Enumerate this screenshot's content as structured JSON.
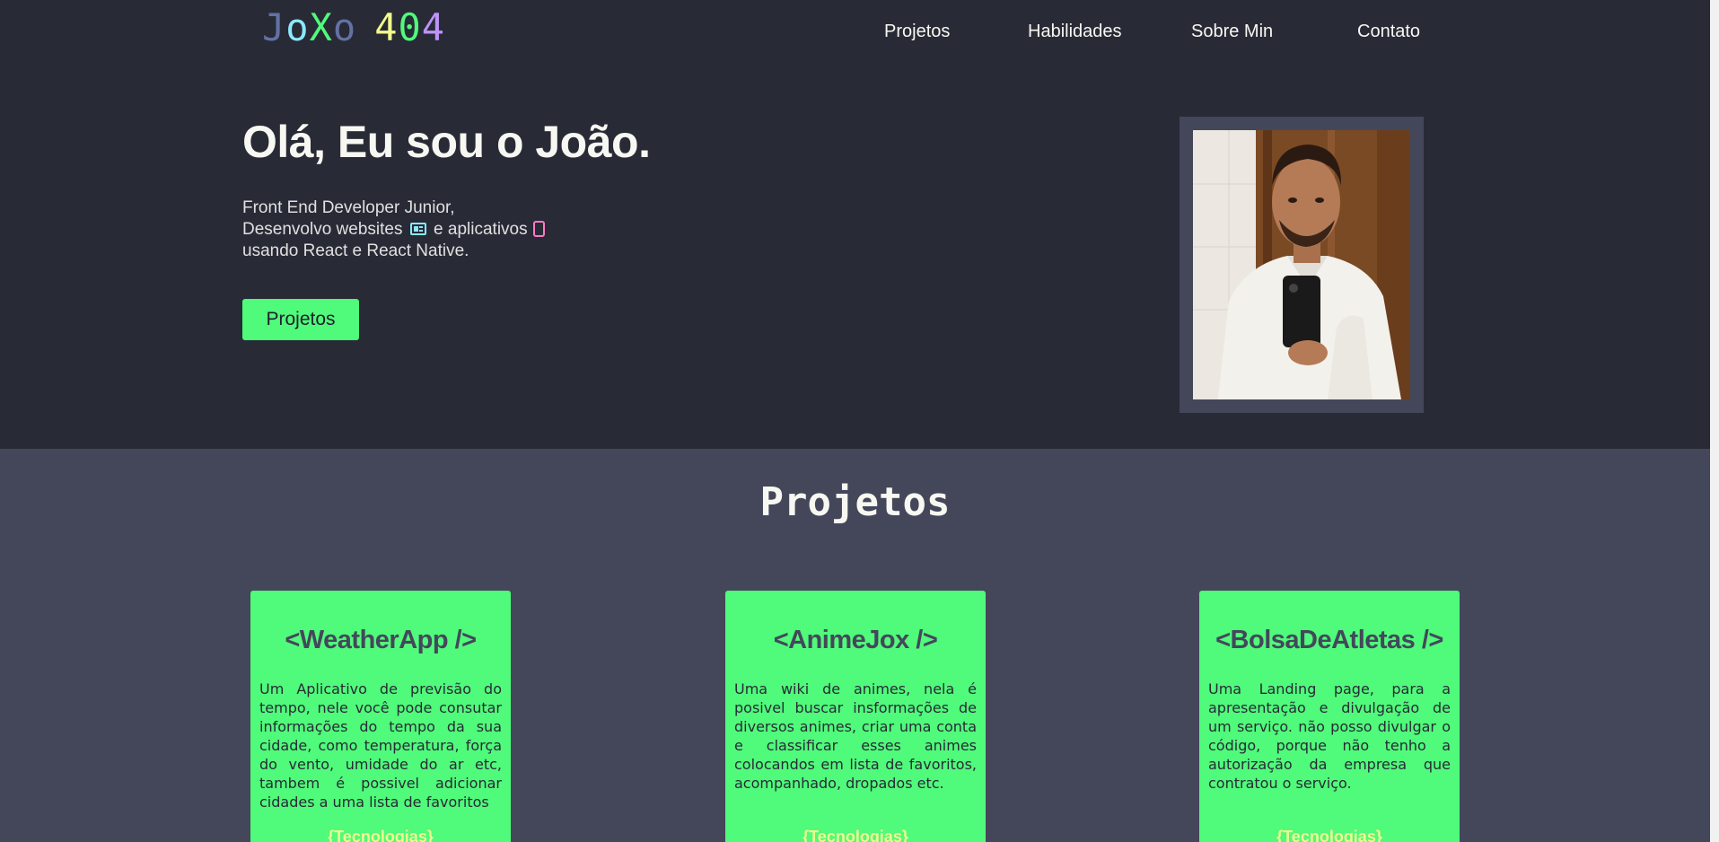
{
  "header": {
    "logo": {
      "part1": "JoXo",
      "part2": "404"
    },
    "nav": [
      {
        "label": "Projetos"
      },
      {
        "label": "Habilidades"
      },
      {
        "label": "Sobre Min"
      },
      {
        "label": "Contato"
      }
    ]
  },
  "hero": {
    "title": "Olá, Eu sou o João.",
    "line1": "Front End Developer Junior,",
    "line2_a": "Desenvolvo websites",
    "line2_b": "e aplicativos",
    "line3": "usando React e React Native.",
    "button_label": "Projetos",
    "icons": [
      "website-icon",
      "mobile-phone-icon"
    ]
  },
  "projects": {
    "title": "Projetos",
    "cards": [
      {
        "title": "<WeatherApp />",
        "description": "Um Aplicativo de previsão do tempo, nele você pode consutar informações do tempo da sua cidade, como temperatura, força do vento, umidade do ar etc, tambem é possivel adicionar cidades a uma lista de favoritos",
        "tech_label": "{Tecnologias}"
      },
      {
        "title": "<AnimeJox />",
        "description": "Uma wiki de animes, nela é posivel buscar insformações de diversos animes, criar uma conta e classificar esses animes colocandos em lista de favoritos, acompanhado, dropados etc.",
        "tech_label": "{Tecnologias}"
      },
      {
        "title": "<BolsaDeAtletas />",
        "description": "Uma Landing page, para a apresentação e divulgação de um serviço. não posso divulgar o código, porque não tenho a autorização da empresa que contratou o serviço.",
        "tech_label": "{Tecnologias}"
      }
    ]
  },
  "colors": {
    "background": "#282a36",
    "section": "#44475a",
    "accent_green": "#50fa7b",
    "accent_yellow": "#f1fa8c",
    "text": "#f8f8f2"
  }
}
